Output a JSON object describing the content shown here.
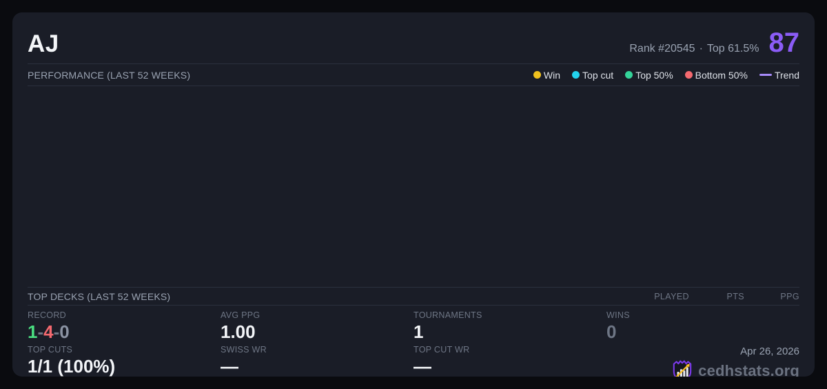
{
  "header": {
    "player_name": "AJ",
    "rank_text": "Rank #20545",
    "separator": "·",
    "top_percent": "Top 61.5%",
    "score": "87",
    "score_color": "#8b5cf6"
  },
  "performance": {
    "title": "PERFORMANCE (LAST 52 WEEKS)",
    "legend": [
      {
        "label": "Win",
        "color": "#f0c11e",
        "type": "dot"
      },
      {
        "label": "Top cut",
        "color": "#22d3ee",
        "type": "dot"
      },
      {
        "label": "Top 50%",
        "color": "#34d399",
        "type": "dot"
      },
      {
        "label": "Bottom 50%",
        "color": "#f4696f",
        "type": "dot"
      },
      {
        "label": "Trend",
        "color": "#a78bfa",
        "type": "line"
      }
    ],
    "chart_points": []
  },
  "top_decks": {
    "title": "TOP DECKS (LAST 52 WEEKS)",
    "columns": [
      "PLAYED",
      "PTS",
      "PPG"
    ],
    "rows": []
  },
  "stats": {
    "record": {
      "label": "RECORD",
      "parts": [
        {
          "text": "1",
          "color": "#4ade80"
        },
        {
          "text": "-",
          "color": "#6e7685"
        },
        {
          "text": "4",
          "color": "#f4696f"
        },
        {
          "text": "-",
          "color": "#6e7685"
        },
        {
          "text": "0",
          "color": "#8b93a3"
        }
      ]
    },
    "top_cuts": {
      "label": "TOP CUTS",
      "value": "1/1 (100%)"
    },
    "avg_ppg": {
      "label": "AVG PPG",
      "value": "1.00"
    },
    "swiss_wr": {
      "label": "SWISS WR",
      "value": "—"
    },
    "tournaments": {
      "label": "TOURNAMENTS",
      "value": "1"
    },
    "top_cut_wr": {
      "label": "TOP CUT WR",
      "value": "—"
    },
    "wins": {
      "label": "WINS",
      "value": "0",
      "muted": true
    }
  },
  "footer": {
    "date": "Apr 26, 2026",
    "site": "cedhstats.org"
  }
}
